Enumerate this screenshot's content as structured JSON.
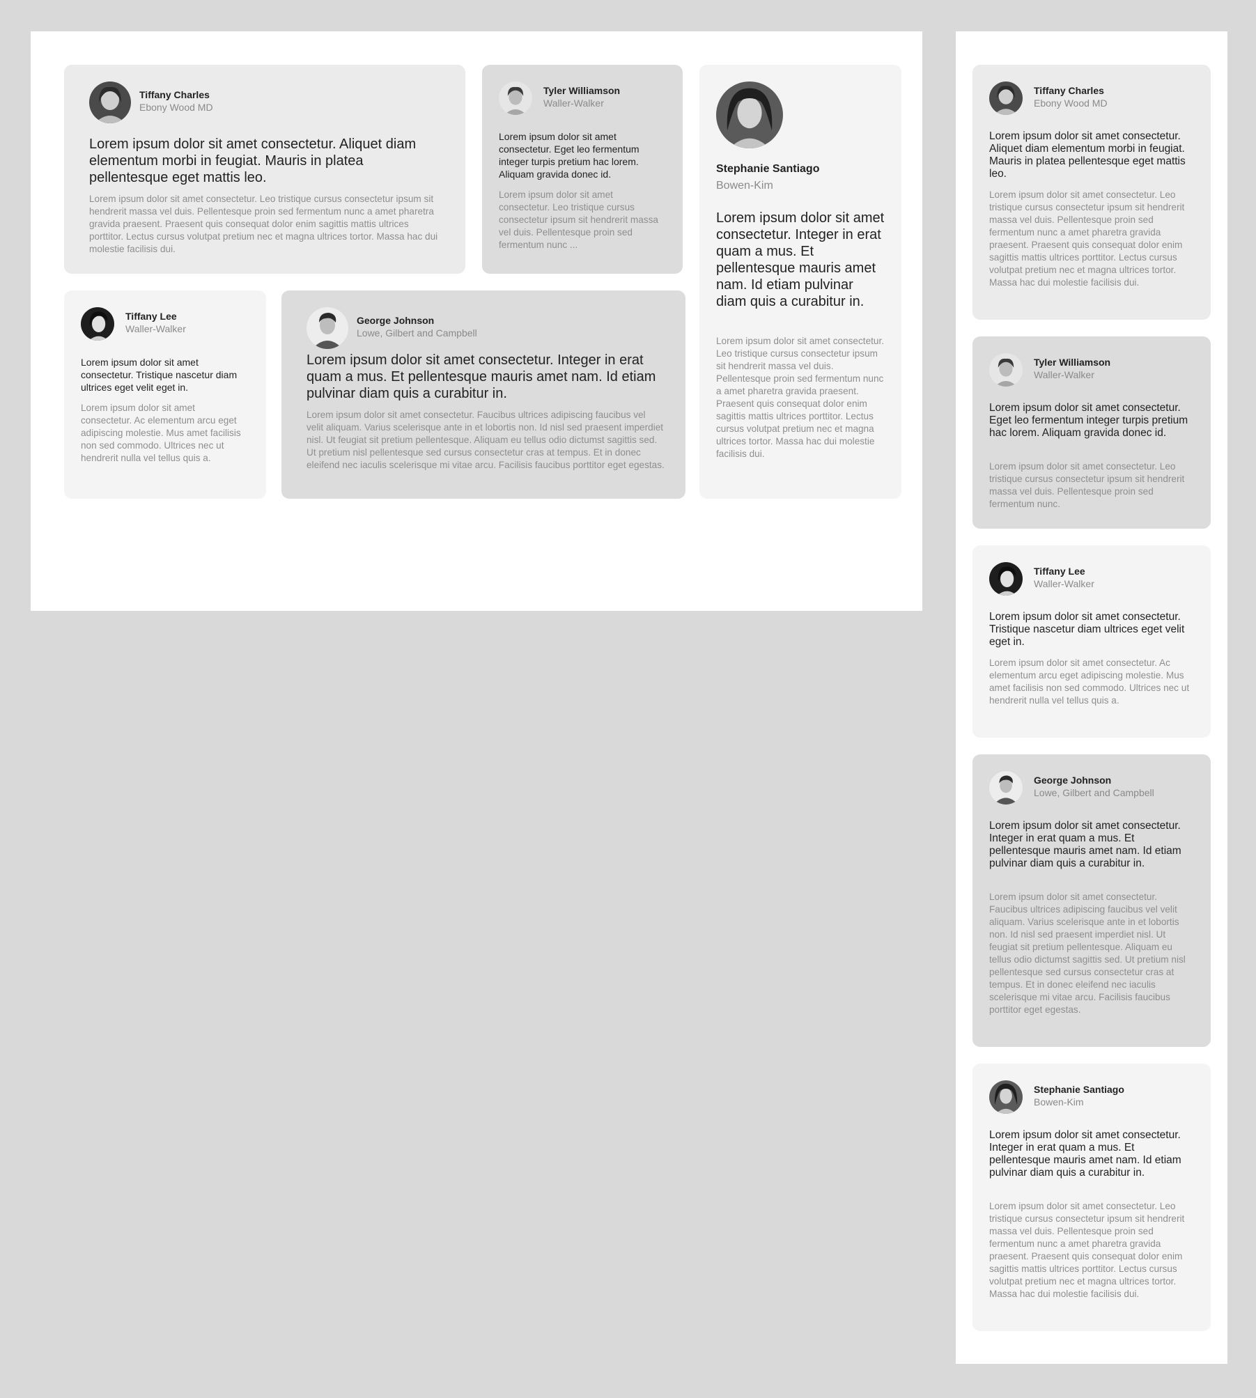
{
  "desktop": {
    "cards": [
      {
        "id": "tiffany-charles",
        "name": "Tiffany Charles",
        "company": "Ebony Wood MD",
        "quote": "Lorem ipsum dolor sit amet consectetur. Aliquet diam elementum morbi in feugiat. Mauris in platea pellentesque eget mattis leo.",
        "body": "Lorem ipsum dolor sit amet consectetur. Leo tristique cursus consectetur ipsum sit hendrerit massa vel duis. Pellentesque proin sed fermentum nunc a amet pharetra gravida praesent. Praesent quis consequat dolor enim sagittis mattis ultrices porttitor. Lectus cursus volutpat pretium nec et magna ultrices tortor. Massa hac dui molestie facilisis dui."
      },
      {
        "id": "tyler-williamson",
        "name": "Tyler Williamson",
        "company": "Waller-Walker",
        "quote": "Lorem ipsum dolor sit amet consectetur. Eget leo fermentum integer turpis pretium hac lorem. Aliquam gravida donec id.",
        "body": "Lorem ipsum dolor sit amet consectetur. Leo tristique cursus consectetur ipsum sit hendrerit massa vel duis. Pellentesque proin sed fermentum nunc ..."
      },
      {
        "id": "stephanie-santiago",
        "name": "Stephanie Santiago",
        "company": "Bowen-Kim",
        "quote": "Lorem ipsum dolor sit amet consectetur. Integer in erat quam a mus. Et pellentesque mauris amet nam. Id etiam pulvinar diam quis a curabitur in.",
        "body": "Lorem ipsum dolor sit amet consectetur. Leo tristique cursus consectetur ipsum sit hendrerit massa vel duis. Pellentesque proin sed fermentum nunc a amet pharetra gravida praesent. Praesent quis consequat dolor enim sagittis mattis ultrices porttitor. Lectus cursus volutpat pretium nec et magna ultrices tortor. Massa hac dui molestie facilisis dui."
      },
      {
        "id": "tiffany-lee",
        "name": "Tiffany Lee",
        "company": "Waller-Walker",
        "quote": "Lorem ipsum dolor sit amet consectetur. Tristique nascetur diam ultrices eget velit eget in.",
        "body": "Lorem ipsum dolor sit amet consectetur. Ac elementum arcu eget adipiscing molestie. Mus amet facilisis non sed commodo. Ultrices nec ut hendrerit nulla vel tellus quis a."
      },
      {
        "id": "george-johnson",
        "name": "George Johnson",
        "company": "Lowe, Gilbert and Campbell",
        "quote": "Lorem ipsum dolor sit amet consectetur. Integer in erat quam a mus. Et pellentesque mauris amet nam. Id etiam pulvinar diam quis a curabitur in.",
        "body": "Lorem ipsum dolor sit amet consectetur. Faucibus ultrices adipiscing faucibus vel velit aliquam. Varius scelerisque ante in et lobortis non. Id nisl sed praesent imperdiet nisl. Ut feugiat sit pretium pellentesque. Aliquam eu tellus odio dictumst sagittis sed. Ut pretium nisl pellentesque sed cursus consectetur cras at tempus. Et in donec eleifend nec iaculis scelerisque mi vitae arcu. Facilisis faucibus porttitor eget egestas."
      }
    ]
  },
  "mobile": {
    "cards": [
      {
        "id": "tiffany-charles",
        "name": "Tiffany Charles",
        "company": "Ebony Wood MD",
        "quote": "Lorem ipsum dolor sit amet consectetur. Aliquet diam elementum morbi in feugiat. Mauris in platea pellentesque eget mattis leo.",
        "body": "Lorem ipsum dolor sit amet consectetur. Leo tristique cursus consectetur ipsum sit hendrerit massa vel duis. Pellentesque proin sed fermentum nunc a amet pharetra gravida praesent. Praesent quis consequat dolor enim sagittis mattis ultrices porttitor. Lectus cursus volutpat pretium nec et magna ultrices tortor. Massa hac dui molestie facilisis dui."
      },
      {
        "id": "tyler-williamson",
        "name": "Tyler Williamson",
        "company": "Waller-Walker",
        "quote": "Lorem ipsum dolor sit amet consectetur. Eget leo fermentum integer turpis pretium hac lorem. Aliquam gravida donec id.",
        "body": "Lorem ipsum dolor sit amet consectetur. Leo tristique cursus consectetur ipsum sit hendrerit massa vel duis. Pellentesque proin sed fermentum nunc."
      },
      {
        "id": "tiffany-lee",
        "name": "Tiffany Lee",
        "company": "Waller-Walker",
        "quote": "Lorem ipsum dolor sit amet consectetur. Tristique nascetur diam ultrices eget velit eget in.",
        "body": "Lorem ipsum dolor sit amet consectetur. Ac elementum arcu eget adipiscing molestie. Mus amet facilisis non sed commodo. Ultrices nec ut hendrerit nulla vel tellus quis a."
      },
      {
        "id": "george-johnson",
        "name": "George Johnson",
        "company": "Lowe, Gilbert and Campbell",
        "quote": "Lorem ipsum dolor sit amet consectetur. Integer in erat quam a mus. Et pellentesque mauris amet nam. Id etiam pulvinar diam quis a curabitur in.",
        "body": "Lorem ipsum dolor sit amet consectetur. Faucibus ultrices adipiscing faucibus vel velit aliquam. Varius scelerisque ante in et lobortis non. Id nisl sed praesent imperdiet nisl. Ut feugiat sit pretium pellentesque. Aliquam eu tellus odio dictumst sagittis sed. Ut pretium nisl pellentesque sed cursus consectetur cras at tempus. Et in donec eleifend nec iaculis scelerisque mi vitae arcu. Facilisis faucibus porttitor eget egestas."
      },
      {
        "id": "stephanie-santiago",
        "name": "Stephanie Santiago",
        "company": "Bowen-Kim",
        "quote": "Lorem ipsum dolor sit amet consectetur. Integer in erat quam a mus. Et pellentesque mauris amet nam. Id etiam pulvinar diam quis a curabitur in.",
        "body": "Lorem ipsum dolor sit amet consectetur. Leo tristique cursus consectetur ipsum sit hendrerit massa vel duis. Pellentesque proin sed fermentum nunc a amet pharetra gravida praesent. Praesent quis consequat dolor enim sagittis mattis ultrices porttitor. Lectus cursus volutpat pretium nec et magna ultrices tortor. Massa hac dui molestie facilisis dui."
      }
    ]
  },
  "colors": {
    "background": "#d9d9d9",
    "frame": "#ffffff",
    "card_light": "#f4f4f4",
    "card_mid": "#ebebeb",
    "card_dark": "#dcdcdc",
    "text_primary": "#222222",
    "text_muted": "#8e8e8e"
  }
}
